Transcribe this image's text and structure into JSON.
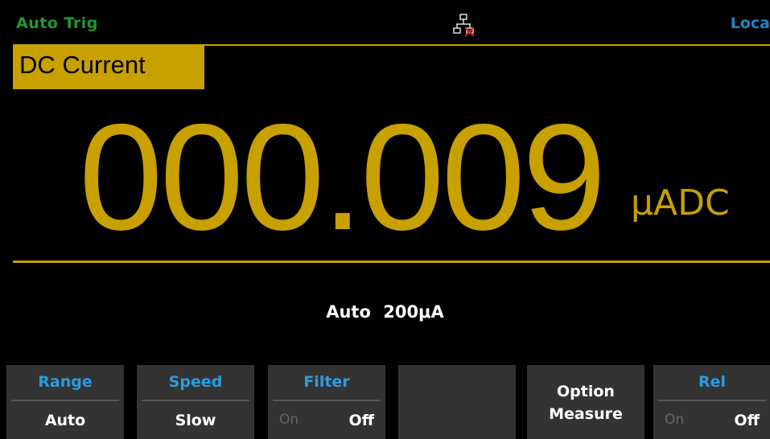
{
  "status": {
    "trigger": "Auto Trig",
    "remote": "Loca"
  },
  "mode": "DC Current",
  "reading": {
    "value": "000.009",
    "unit": "μADC"
  },
  "range_info": {
    "mode": "Auto",
    "range": "200μA"
  },
  "softkeys": {
    "range": {
      "title": "Range",
      "value": "Auto"
    },
    "speed": {
      "title": "Speed",
      "value": "Slow"
    },
    "filter": {
      "title": "Filter",
      "on": "On",
      "off": "Off"
    },
    "option": {
      "line1": "Option",
      "line2": "Measure"
    },
    "rel": {
      "title": "Rel",
      "on": "On",
      "off": "Off"
    }
  },
  "colors": {
    "accent": "#c8a000",
    "trigger": "#1f9a2a",
    "softkey_title": "#2a9be0"
  },
  "icons": [
    "lan-disconnected-icon"
  ]
}
